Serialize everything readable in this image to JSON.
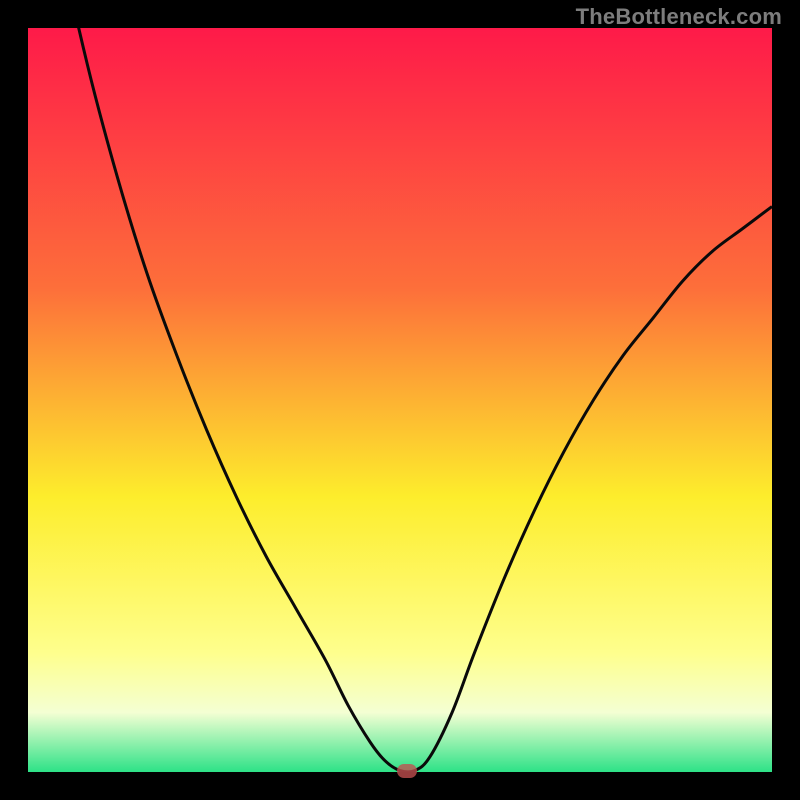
{
  "watermark_text": "TheBottleneck.com",
  "colors": {
    "frame": "#000000",
    "gradient_top": "#fe1a49",
    "gradient_mid_upper": "#fd6f3a",
    "gradient_mid": "#fded2c",
    "gradient_lower": "#feff8d",
    "gradient_band": "#f4ffd3",
    "gradient_bottom": "#2de287",
    "curve": "#0a0a0a",
    "marker": "rgba(195,80,80,0.78)"
  },
  "chart_data": {
    "type": "line",
    "title": "",
    "xlabel": "",
    "ylabel": "",
    "xlim": [
      0,
      100
    ],
    "ylim": [
      0,
      100
    ],
    "x": [
      0,
      4,
      8,
      12,
      16,
      20,
      24,
      28,
      32,
      36,
      40,
      43,
      46,
      48,
      50,
      52,
      54,
      57,
      60,
      64,
      68,
      72,
      76,
      80,
      84,
      88,
      92,
      96,
      100
    ],
    "series": [
      {
        "name": "bottleneck-curve",
        "values": [
          135,
          113,
          95,
          80,
          67,
          56,
          46,
          37,
          29,
          22,
          15,
          9,
          4,
          1.5,
          0.2,
          0.2,
          2,
          8,
          16,
          26,
          35,
          43,
          50,
          56,
          61,
          66,
          70,
          73,
          76
        ]
      }
    ],
    "marker": {
      "x": 51,
      "y": 0.2
    },
    "gradient_stops": [
      {
        "offset": 0,
        "color": "#fe1a49"
      },
      {
        "offset": 0.35,
        "color": "#fd6f3a"
      },
      {
        "offset": 0.63,
        "color": "#fded2c"
      },
      {
        "offset": 0.84,
        "color": "#feff8d"
      },
      {
        "offset": 0.92,
        "color": "#f4ffd3"
      },
      {
        "offset": 1.0,
        "color": "#2de287"
      }
    ]
  }
}
